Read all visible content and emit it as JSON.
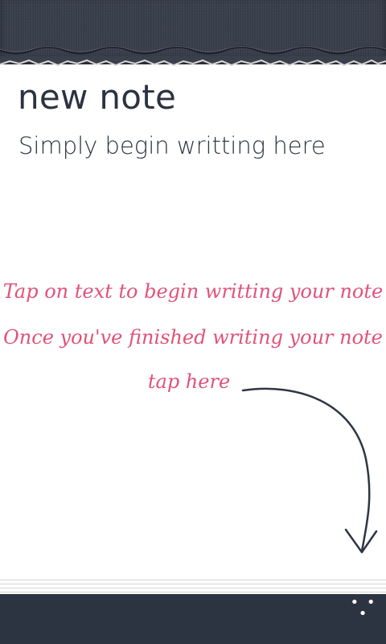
{
  "note": {
    "title": "new note",
    "body_placeholder": "Simply begin writting here"
  },
  "hint": {
    "line1": "Tap on text to begin writting your note",
    "line2": "Once you've finished writing your note",
    "line3": "tap here"
  },
  "appbar": {
    "more_glyph": "• • •"
  },
  "colors": {
    "header": "#353b47",
    "text": "#2c3340",
    "hint": "#e0527a",
    "appbar": "#2d3441"
  }
}
